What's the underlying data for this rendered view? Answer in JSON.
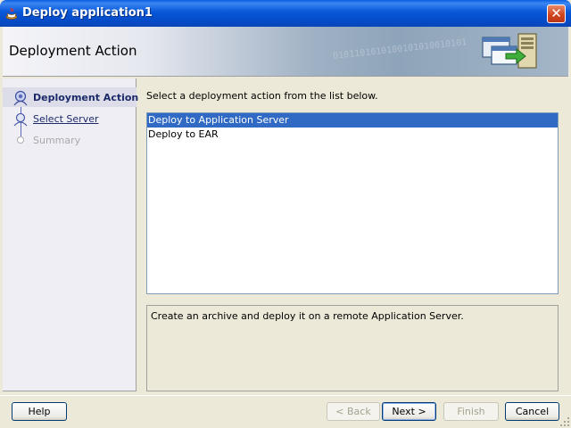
{
  "window": {
    "title": "Deploy application1",
    "close_icon": "close-icon"
  },
  "header": {
    "title": "Deployment Action",
    "decoration_bits": "0101101010100101010010101"
  },
  "nav": {
    "steps": [
      {
        "label": "Deployment Action",
        "state": "active"
      },
      {
        "label": "Select Server",
        "state": "link"
      },
      {
        "label": "Summary",
        "state": "disabled"
      }
    ]
  },
  "main": {
    "instruction": "Select a deployment action from the list below.",
    "actions": [
      {
        "label": "Deploy to Application Server",
        "selected": true
      },
      {
        "label": "Deploy to EAR",
        "selected": false
      }
    ],
    "description": "Create an archive and deploy it on a remote Application Server."
  },
  "buttons": {
    "help": "Help",
    "back": "< Back",
    "next": "Next >",
    "finish": "Finish",
    "cancel": "Cancel"
  },
  "colors": {
    "titlebar": "#0757d8",
    "selection": "#316ac5",
    "nav_link": "#1c2a6a"
  }
}
